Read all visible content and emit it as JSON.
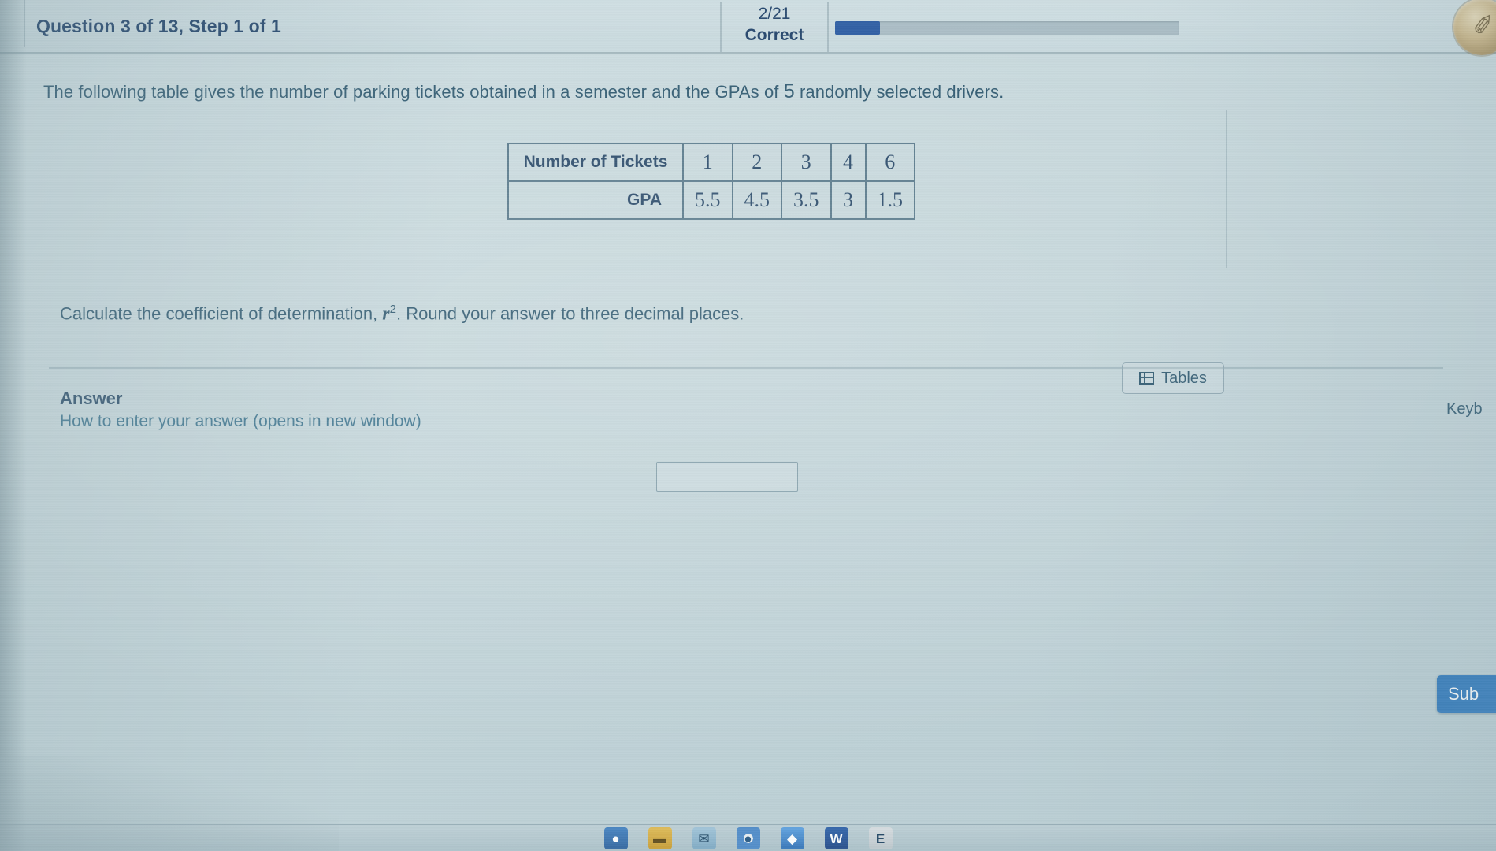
{
  "header": {
    "question_title": "Question 3 of 13, Step 1 of 1",
    "score_fraction": "2/21",
    "score_label": "Correct",
    "progress_percent": 13,
    "progress_fill_color": "#1c4f9c",
    "progress_track_color": "#a6b9c2",
    "badge_icon": "clock-badge-icon",
    "badge_glyph": "✐"
  },
  "main": {
    "question_text_before": "The following table gives the number of parking tickets obtained in a semester and the GPAs of ",
    "question_text_count": "5",
    "question_text_after": " randomly selected drivers.",
    "table": {
      "row_headers": [
        "Number of Tickets",
        "GPA"
      ],
      "tickets": [
        "1",
        "2",
        "3",
        "4",
        "6"
      ],
      "gpa": [
        "5.5",
        "4.5",
        "3.5",
        "3",
        "1.5"
      ]
    },
    "prompt_before": "Calculate the coefficient of determination, ",
    "prompt_var": "r",
    "prompt_exp": "2",
    "prompt_after": ". Round your answer to three decimal places."
  },
  "answer_section": {
    "heading": "Answer",
    "help_link": "How to enter your answer (opens in new window)",
    "input_value": "",
    "input_placeholder": ""
  },
  "tools": {
    "tables_button": "Tables",
    "tables_icon": "grid-table-icon",
    "keyboard_link": "Keyb",
    "submit_button": "Sub"
  },
  "taskbar": {
    "items": [
      {
        "name": "search-icon",
        "glyph": "●"
      },
      {
        "name": "folder-icon",
        "glyph": "▬"
      },
      {
        "name": "mail-icon",
        "glyph": "✉"
      },
      {
        "name": "chrome-icon",
        "glyph": "●"
      },
      {
        "name": "app-blue-icon",
        "glyph": "◆"
      },
      {
        "name": "word-icon",
        "glyph": "W"
      },
      {
        "name": "excel-icon",
        "glyph": "E"
      }
    ]
  },
  "colors": {
    "page_background": "#c6d7db",
    "text_primary": "#1d4a63",
    "title_color": "#10335e",
    "accent_blue": "#1f6fb8",
    "table_border": "#4a6d80"
  }
}
